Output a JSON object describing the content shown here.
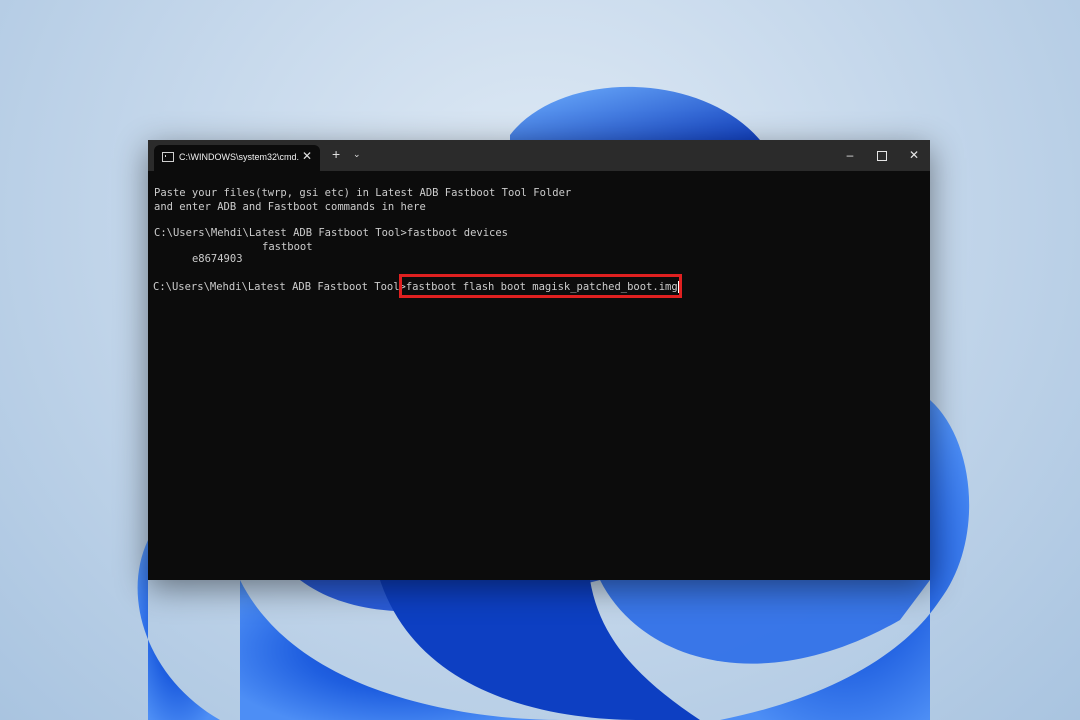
{
  "tab": {
    "title": "C:\\WINDOWS\\system32\\cmd.",
    "close_glyph": "✕",
    "new_tab_glyph": "+",
    "dropdown_glyph": "⌄"
  },
  "window_controls": {
    "minimize_glyph": "–",
    "close_glyph": "✕"
  },
  "console": {
    "lines": [
      "Paste your files(twrp, gsi etc) in Latest ADB Fastboot Tool Folder",
      "and enter ADB and Fastboot commands in here",
      "C:\\Users\\Mehdi\\Latest ADB Fastboot Tool>fastboot devices",
      "C:\\Users\\Mehdi\\Latest ADB Fastboot Tool>fastboot flash boot magisk_patched_boot.img"
    ],
    "device_id": "e8674903",
    "device_status": "fastboot"
  },
  "colors": {
    "terminal_bg": "#0c0c0c",
    "titlebar_bg": "#2b2b2b",
    "text": "#cccccc",
    "highlight": "#e02020",
    "wallpaper_blue": "#1f5fe0"
  }
}
